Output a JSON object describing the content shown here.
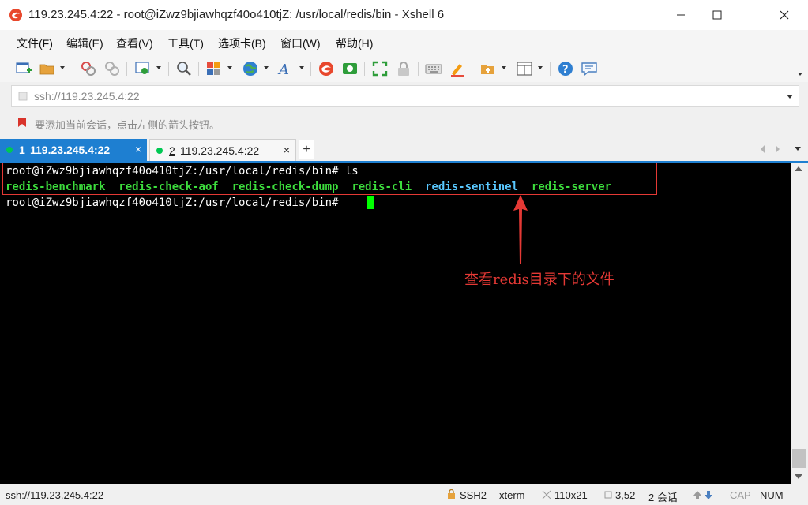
{
  "window": {
    "title": "119.23.245.4:22 - root@iZwz9bjiawhqzf40o410tjZ: /usr/local/redis/bin - Xshell 6"
  },
  "menu": {
    "items": [
      "文件(F)",
      "编辑(E)",
      "查看(V)",
      "工具(T)",
      "选项卡(B)",
      "窗口(W)",
      "帮助(H)"
    ]
  },
  "address_bar": {
    "value": "ssh://119.23.245.4:22"
  },
  "hint_bar": {
    "text": "要添加当前会话，点击左侧的箭头按钮。"
  },
  "tabs": [
    {
      "number": "1",
      "label": "119.23.245.4:22",
      "active": true
    },
    {
      "number": "2",
      "label": "119.23.245.4:22",
      "active": false
    }
  ],
  "tab_close_glyph": "×",
  "tab_add_glyph": "+",
  "terminal": {
    "prompt": "root@iZwz9bjiawhqzf40o410tjZ:/usr/local/redis/bin#",
    "command": " ls",
    "ls_output": [
      {
        "name": "redis-benchmark",
        "color": "#3dde3d"
      },
      {
        "name": "redis-check-aof",
        "color": "#3dde3d"
      },
      {
        "name": "redis-check-dump",
        "color": "#3dde3d"
      },
      {
        "name": "redis-cli",
        "color": "#3dde3d"
      },
      {
        "name": "redis-sentinel",
        "color": "#59c8ff"
      },
      {
        "name": "redis-server",
        "color": "#3dde3d"
      }
    ],
    "prompt2": "root@iZwz9bjiawhqzf40o410tjZ:/usr/local/redis/bin#"
  },
  "annotation": {
    "text": "查看redis目录下的文件",
    "color": "#e53935"
  },
  "status_bar": {
    "connection": "ssh://119.23.245.4:22",
    "protocol": "SSH2",
    "terminal_type": "xterm",
    "size": "110x21",
    "cursor_pos": "3,52",
    "sessions": "2 会话",
    "caps": "CAP",
    "num": "NUM"
  },
  "colors": {
    "tab_active": "#1e7fd1",
    "terminal_bg": "#000000",
    "cursor": "#00ff00"
  }
}
